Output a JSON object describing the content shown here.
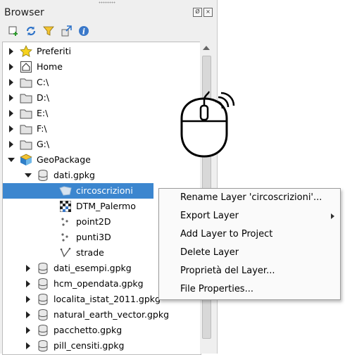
{
  "panel": {
    "title": "Browser",
    "float_btn": "Ø",
    "close_btn": "×"
  },
  "toolbar": {
    "icons": [
      "add-layer-icon",
      "refresh-icon",
      "filter-icon",
      "collapse-icon",
      "info-icon"
    ]
  },
  "tree": {
    "items": [
      {
        "label": "Preferiti",
        "icon": "star-icon"
      },
      {
        "label": "Home",
        "icon": "home-icon"
      },
      {
        "label": "C:\\",
        "icon": "folder-icon"
      },
      {
        "label": "D:\\",
        "icon": "folder-icon"
      },
      {
        "label": "E:\\",
        "icon": "folder-icon"
      },
      {
        "label": "F:\\",
        "icon": "folder-icon"
      },
      {
        "label": "G:\\",
        "icon": "folder-icon"
      },
      {
        "label": "GeoPackage",
        "icon": "geopackage-icon"
      },
      {
        "label": "dati.gpkg",
        "icon": "database-icon"
      },
      {
        "label": "circoscrizioni",
        "icon": "polygon-layer-icon"
      },
      {
        "label": "DTM_Palermo",
        "icon": "raster-layer-icon"
      },
      {
        "label": "point2D",
        "icon": "point-layer-icon"
      },
      {
        "label": "punti3D",
        "icon": "point-layer-icon"
      },
      {
        "label": "strade",
        "icon": "line-layer-icon"
      },
      {
        "label": "dati_esempi.gpkg",
        "icon": "database-icon"
      },
      {
        "label": "hcm_opendata.gpkg",
        "icon": "database-icon"
      },
      {
        "label": "localita_istat_2011.gpkg",
        "icon": "database-icon"
      },
      {
        "label": "natural_earth_vector.gpkg",
        "icon": "database-icon"
      },
      {
        "label": "pacchetto.gpkg",
        "icon": "database-icon"
      },
      {
        "label": "pill_censiti.gpkg",
        "icon": "database-icon"
      }
    ]
  },
  "context_menu": {
    "items": [
      "Rename Layer 'circoscrizioni'...",
      "Export Layer",
      "Add Layer to Project",
      "Delete Layer",
      "Proprietà del Layer...",
      "File Properties..."
    ]
  },
  "colors": {
    "selection": "#3c86cf",
    "panel_bg": "#efefef",
    "folder": "#d7d7d7",
    "star": "#f6d21c"
  }
}
